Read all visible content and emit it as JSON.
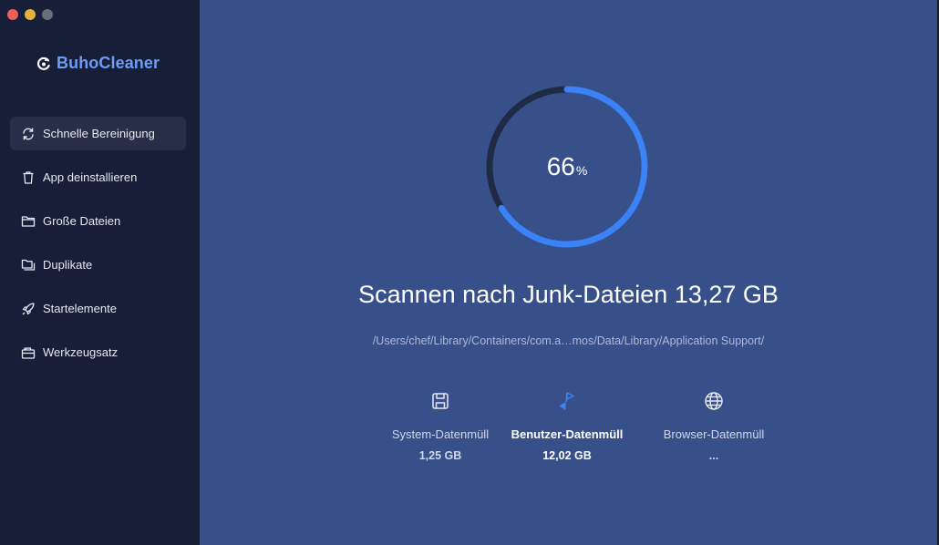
{
  "app": {
    "name": "BuhoCleaner"
  },
  "sidebar": {
    "items": [
      {
        "label": "Schnelle Bereinigung",
        "icon": "refresh-icon",
        "active": true
      },
      {
        "label": "App deinstallieren",
        "icon": "trash-icon",
        "active": false
      },
      {
        "label": "Große Dateien",
        "icon": "folder-icon",
        "active": false
      },
      {
        "label": "Duplikate",
        "icon": "duplicate-folder-icon",
        "active": false
      },
      {
        "label": "Startelemente",
        "icon": "rocket-icon",
        "active": false
      },
      {
        "label": "Werkzeugsatz",
        "icon": "toolbox-icon",
        "active": false
      }
    ]
  },
  "scan": {
    "progress_value": "66",
    "progress_unit": "%",
    "progress_fraction": 0.66,
    "headline": "Scannen nach Junk-Dateien 13,27 GB",
    "current_path": "/Users/chef/Library/Containers/com.a…mos/Data/Library/Application Support/"
  },
  "categories": [
    {
      "label": "System-Datenmüll",
      "value": "1,25 GB",
      "icon": "disk-icon",
      "active": false
    },
    {
      "label": "Benutzer-Datenmüll",
      "value": "12,02 GB",
      "icon": "user-flag-icon",
      "active": true
    },
    {
      "label": "Browser-Datenmüll",
      "value": "...",
      "icon": "globe-icon",
      "active": false
    }
  ],
  "colors": {
    "accent": "#3b82f6",
    "brand": "#6e9cf7",
    "sidebar_bg": "#161e38",
    "main_bg": "#38508a",
    "ring_track": "#1f2a44"
  }
}
